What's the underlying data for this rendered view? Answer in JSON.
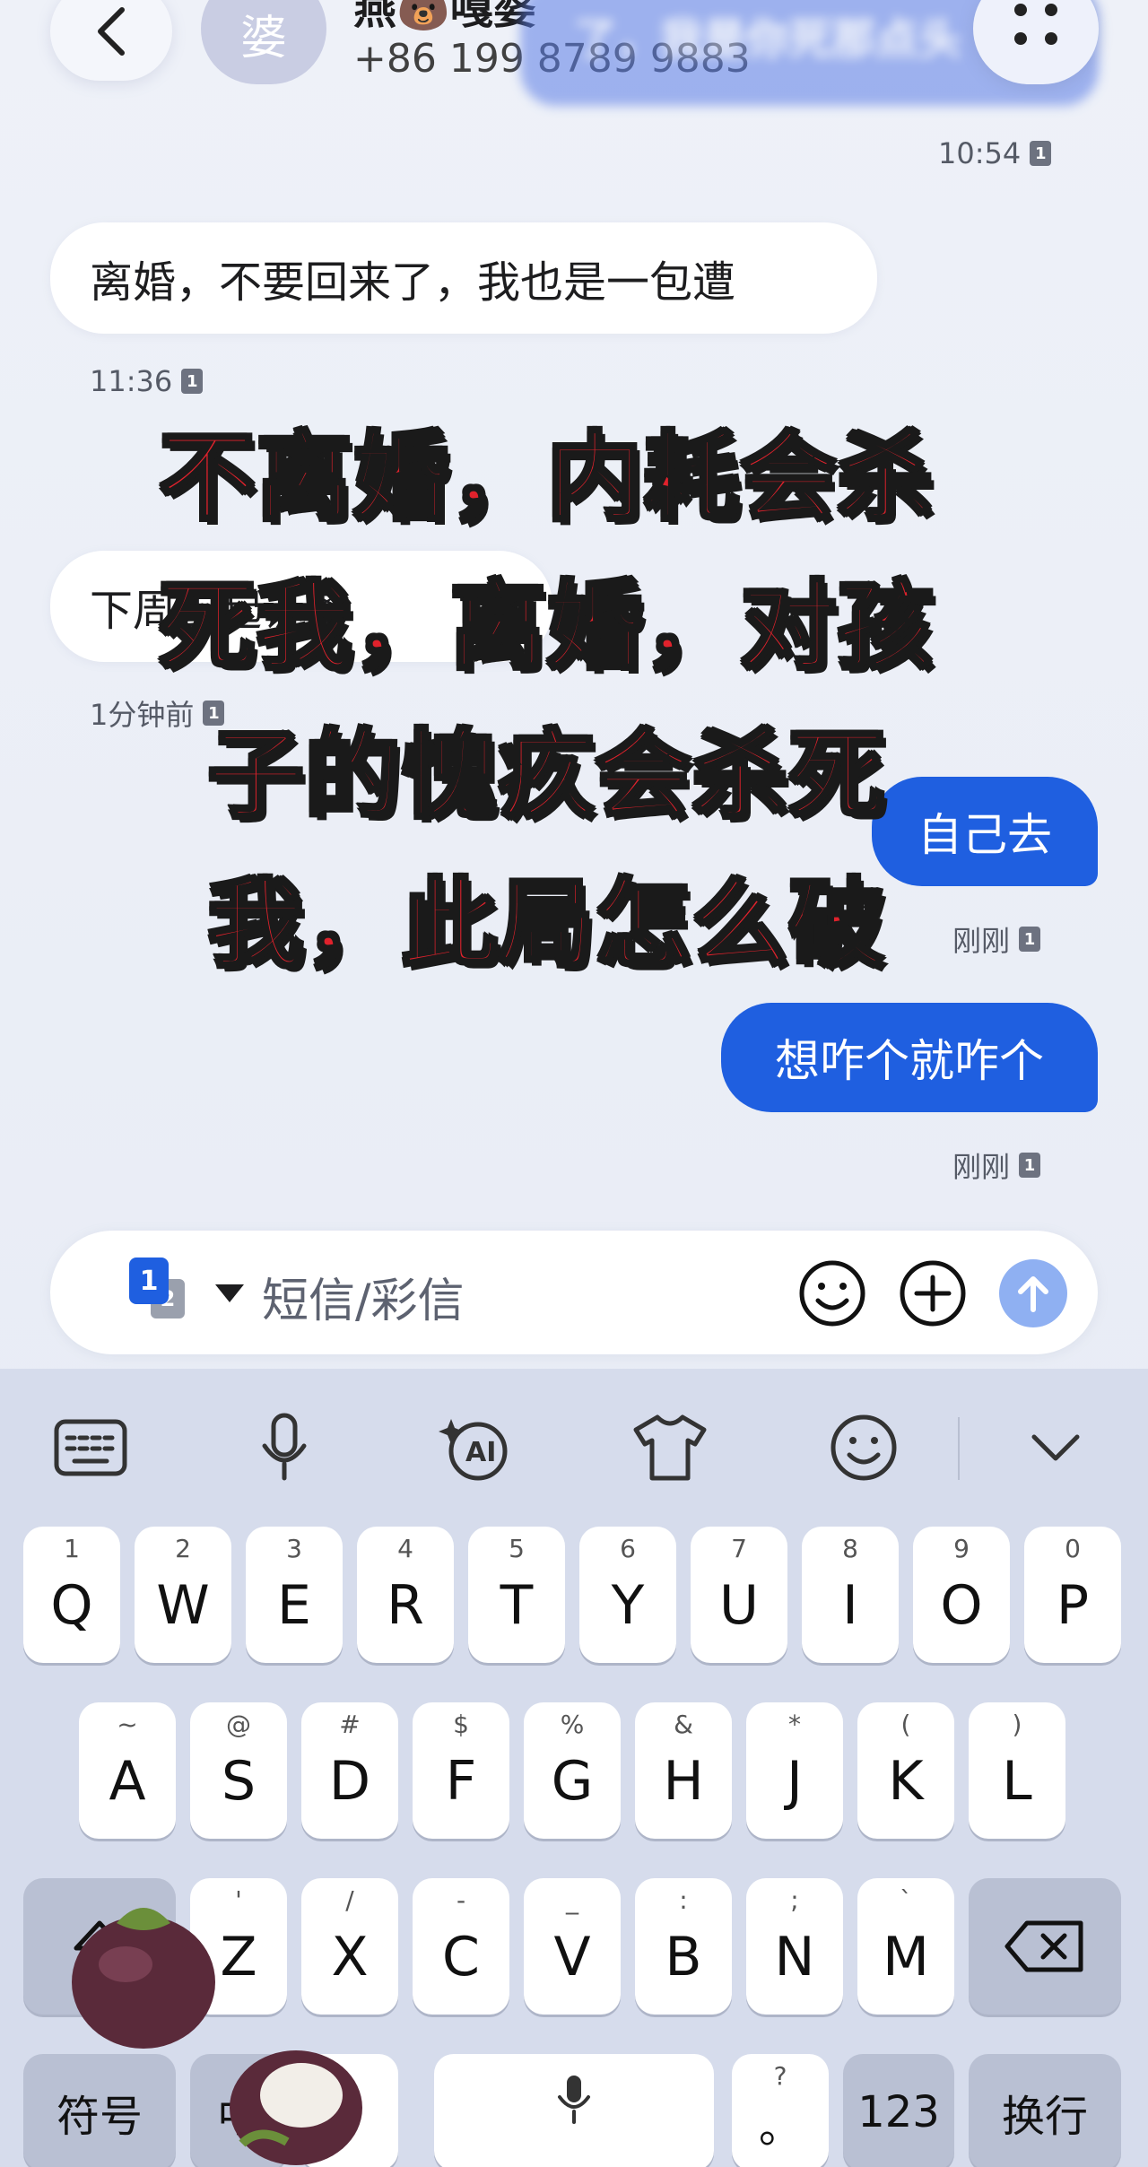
{
  "header": {
    "contact_name": "燕🐻嘎婆",
    "avatar_letter": "婆",
    "phone": "+86 199 8789 9883",
    "pinned_preview": "了，我是你死那点头"
  },
  "messages": [
    {
      "type": "time",
      "text": "10:54",
      "sim": "1"
    },
    {
      "type": "in",
      "text": "离婚，不要回来了，我也是一包遭"
    },
    {
      "type": "time",
      "text": "11:36",
      "sim": "1"
    },
    {
      "type": "in",
      "text": "下周去起诉离"
    },
    {
      "type": "time",
      "text": "1分钟前",
      "sim": "1"
    },
    {
      "type": "out",
      "text": "自己去"
    },
    {
      "type": "time",
      "text": "刚刚",
      "sim": "1"
    },
    {
      "type": "out",
      "text": "想咋个就咋个"
    },
    {
      "type": "time",
      "text": "刚刚",
      "sim": "1"
    }
  ],
  "overlay_caption": [
    "不离婚，内耗会杀",
    "死我，离婚，对孩",
    "子的愧疚会杀死",
    "我，此局怎么破"
  ],
  "composer": {
    "sim_primary": "1",
    "sim_secondary": "2",
    "placeholder": "短信/彩信"
  },
  "keyboard": {
    "row1": [
      {
        "key": "Q",
        "hint": "1"
      },
      {
        "key": "W",
        "hint": "2"
      },
      {
        "key": "E",
        "hint": "3"
      },
      {
        "key": "R",
        "hint": "4"
      },
      {
        "key": "T",
        "hint": "5"
      },
      {
        "key": "Y",
        "hint": "6"
      },
      {
        "key": "U",
        "hint": "7"
      },
      {
        "key": "I",
        "hint": "8"
      },
      {
        "key": "O",
        "hint": "9"
      },
      {
        "key": "P",
        "hint": "0"
      }
    ],
    "row2": [
      {
        "key": "A",
        "hint": "~"
      },
      {
        "key": "S",
        "hint": "@"
      },
      {
        "key": "D",
        "hint": "#"
      },
      {
        "key": "F",
        "hint": "$"
      },
      {
        "key": "G",
        "hint": "%"
      },
      {
        "key": "H",
        "hint": "&"
      },
      {
        "key": "J",
        "hint": "*"
      },
      {
        "key": "K",
        "hint": "("
      },
      {
        "key": "L",
        "hint": ")"
      }
    ],
    "row3": [
      {
        "key": "Z",
        "hint": "'"
      },
      {
        "key": "X",
        "hint": "/"
      },
      {
        "key": "C",
        "hint": "-"
      },
      {
        "key": "V",
        "hint": "_"
      },
      {
        "key": "B",
        "hint": ":"
      },
      {
        "key": "N",
        "hint": ";"
      },
      {
        "key": "M",
        "hint": "`"
      }
    ],
    "bottom": {
      "symbols": "符号",
      "lang": "中",
      "comma": "，",
      "period": "。",
      "period_hint": "?",
      "numbers": "123",
      "enter": "换行"
    }
  },
  "colors": {
    "accent": "#1f5fe0",
    "caption_red": "#e0222c"
  }
}
